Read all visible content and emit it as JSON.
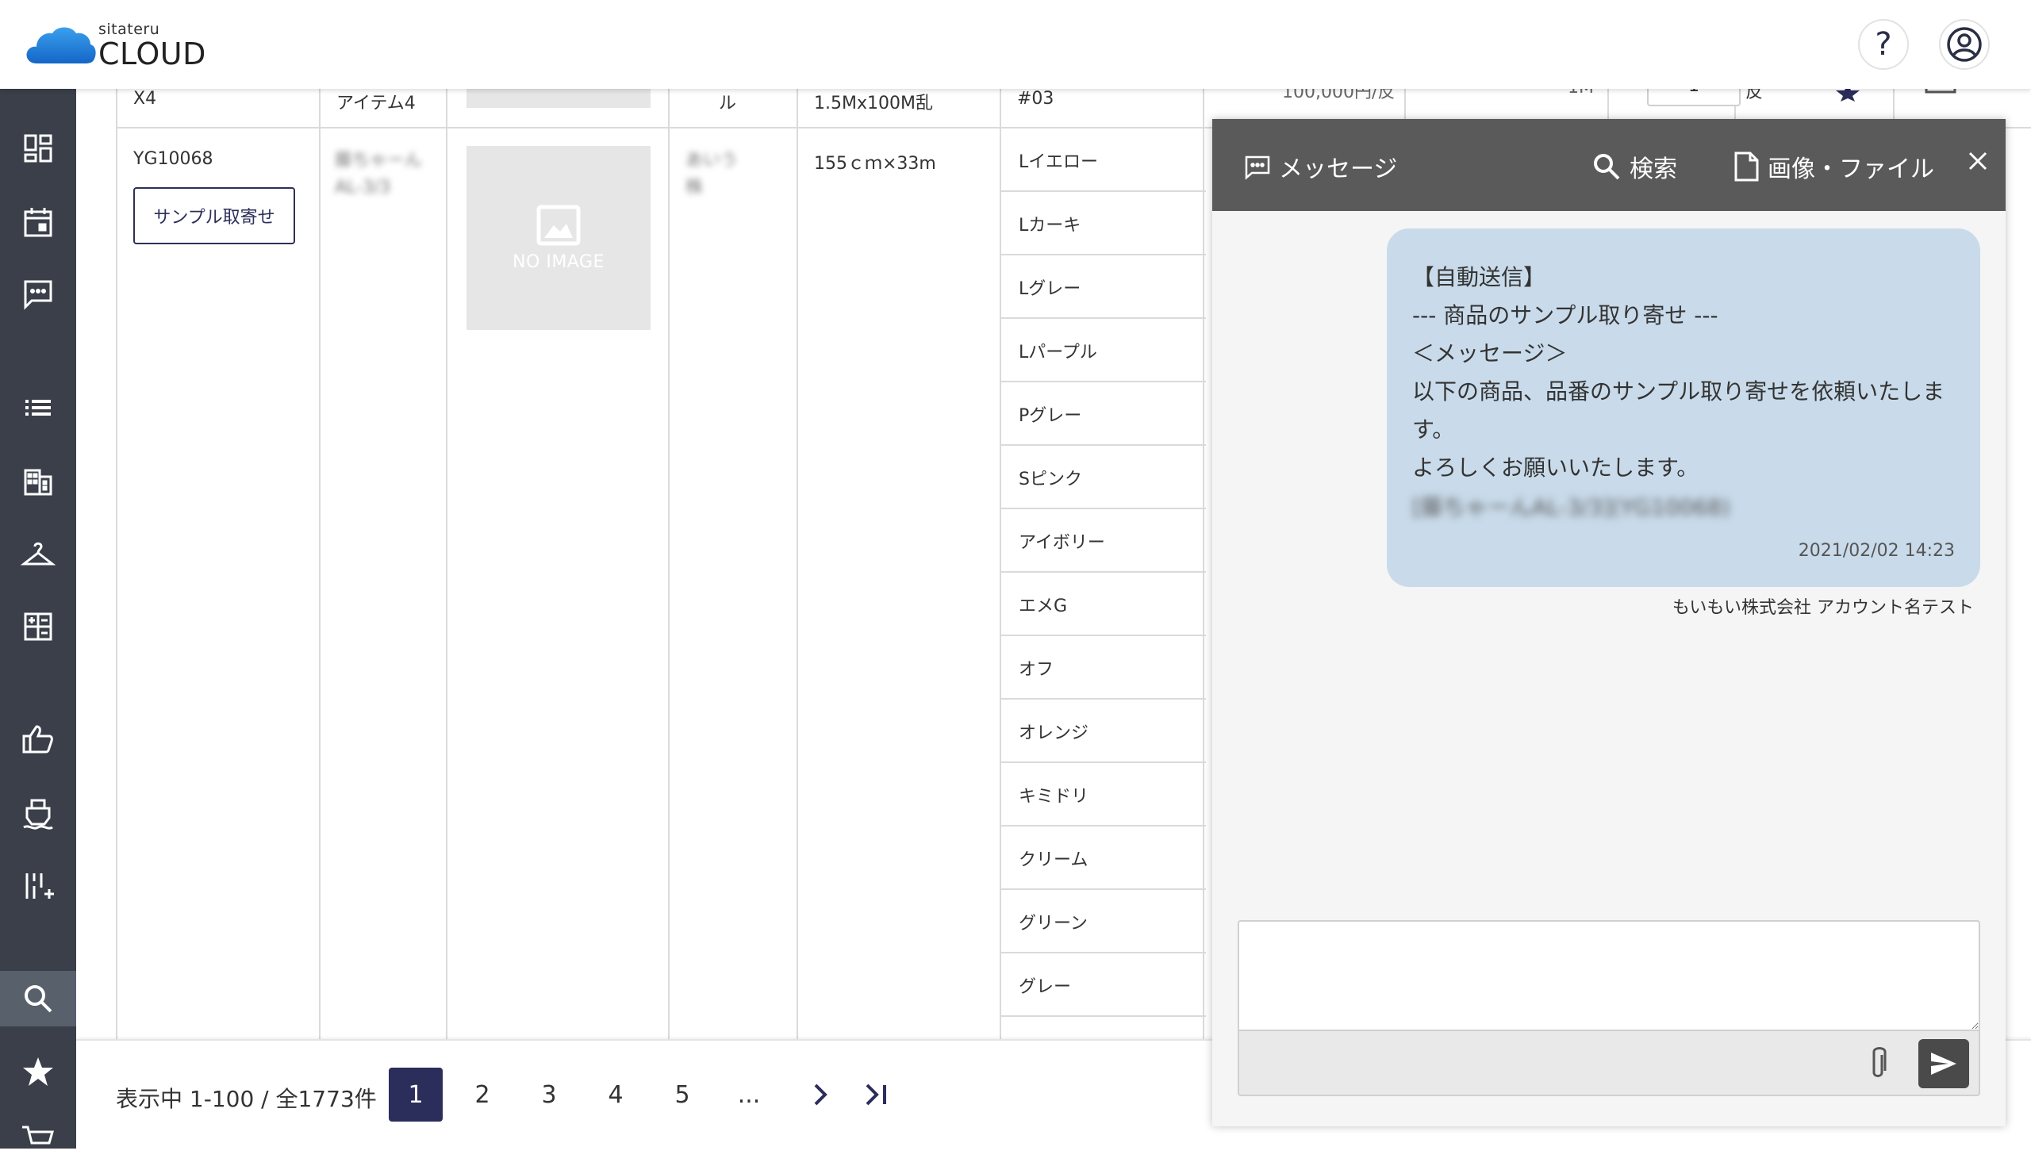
{
  "header": {
    "logo_small": "sitateru",
    "logo_big": "CLOUD",
    "help_label": "?"
  },
  "table": {
    "top_row": {
      "col1": "X4",
      "col2": "アイテム4",
      "col4": "ル",
      "col5": "1.5Mx100M乱",
      "col6": "#03",
      "col7": "100,000円/反",
      "col8": "1M",
      "qty": "1",
      "unit": "反"
    },
    "main_row": {
      "code": "YG10068",
      "sample_button": "サンプル取寄せ",
      "blurred_name": "藤ちゃーんAL-3/3",
      "blurred_supplier": "あいう株",
      "noimage_label": "NO IMAGE",
      "size": "155ｃｍ×33m"
    },
    "colors": [
      "Lイエロー",
      "Lカーキ",
      "Lグレー",
      "Lパープル",
      "Pグレー",
      "Sピンク",
      "アイボリー",
      "エメG",
      "オフ",
      "オレンジ",
      "キミドリ",
      "クリーム",
      "グリーン",
      "グレー"
    ]
  },
  "pager": {
    "info": "表示中 1-100 / 全1773件",
    "pages": [
      "1",
      "2",
      "3",
      "4",
      "5",
      "..."
    ]
  },
  "message_panel": {
    "tab_message": "メッセージ",
    "tab_search": "検索",
    "tab_files": "画像・ファイル",
    "bubble_lines": [
      "【自動送信】",
      "--- 商品のサンプル取り寄せ ---",
      "＜メッセージ＞",
      "以下の商品、品番のサンプル取り寄せを依頼いたしま",
      "す。",
      "よろしくお願いいたします。"
    ],
    "bubble_blurred": "[藤ちゃーんAL-3/3](YG10068)",
    "timestamp": "2021/02/02 14:23",
    "sender": "もいもい株式会社 アカウント名テスト",
    "input_value": ""
  },
  "colors": {
    "sidebar_bg": "#3a3f4a",
    "accent": "#2b2d5b",
    "panel_header": "#5a5a5a",
    "bubble": "#c9dbea",
    "logo_blue": "#1f7fd6"
  }
}
